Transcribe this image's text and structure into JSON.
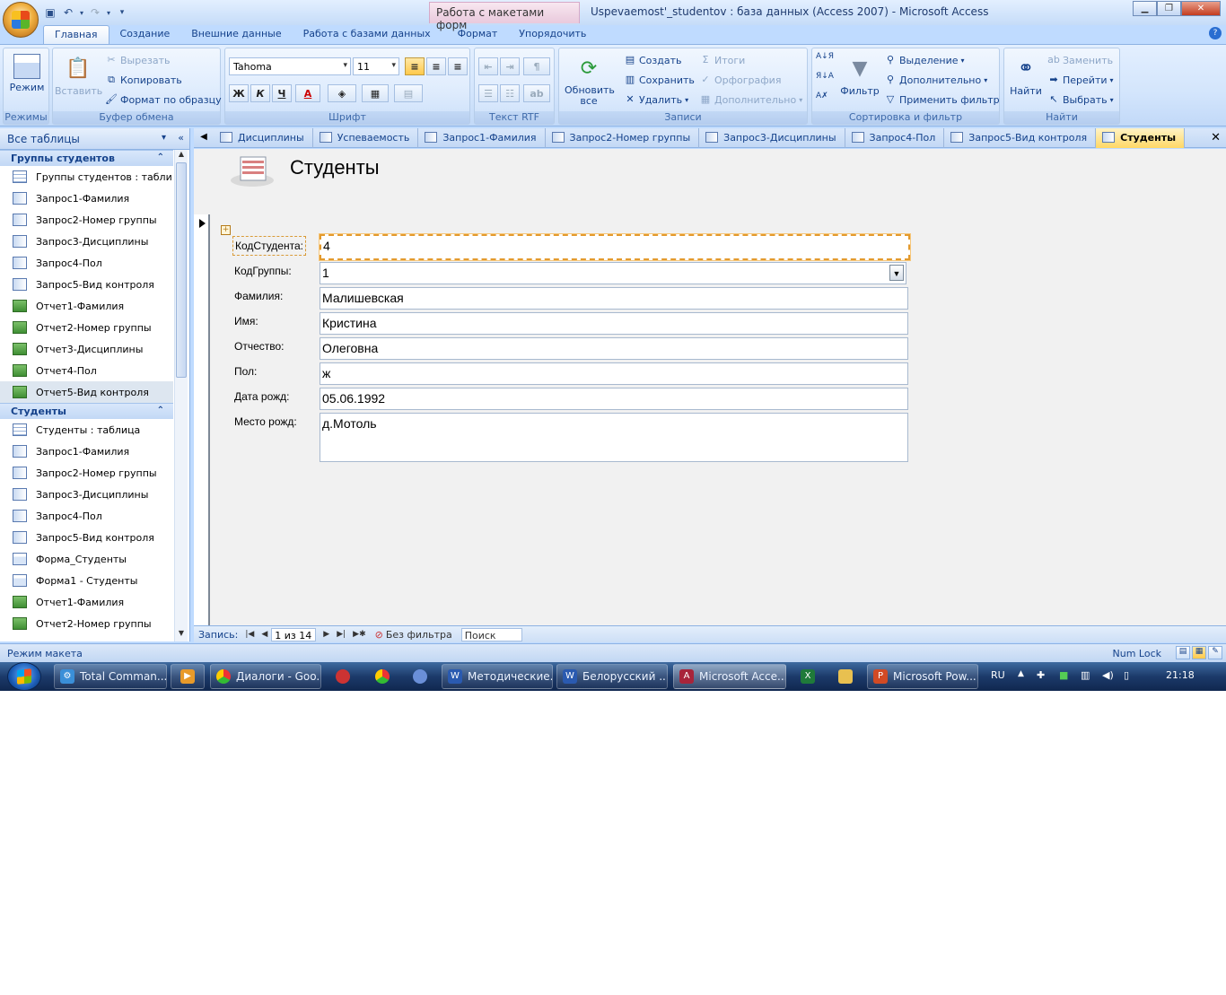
{
  "window": {
    "context_tab": "Работа с макетами форм",
    "title": "Uspevaemost'_studentov : база данных (Access 2007) - Microsoft Access"
  },
  "ribbon_tabs": [
    "Главная",
    "Создание",
    "Внешние данные",
    "Работа с базами данных",
    "Формат",
    "Упорядочить"
  ],
  "ribbon": {
    "views": {
      "mode": "Режим",
      "group": "Режимы"
    },
    "clipboard": {
      "paste": "Вставить",
      "cut": "Вырезать",
      "copy": "Копировать",
      "format_painter": "Формат по образцу",
      "group": "Буфер обмена"
    },
    "font": {
      "name": "Tahoma",
      "size": "11",
      "group": "Шрифт"
    },
    "rtf": {
      "group": "Текст RTF"
    },
    "records": {
      "refresh": "Обновить все",
      "new": "Создать",
      "save": "Сохранить",
      "delete": "Удалить",
      "totals": "Итоги",
      "spelling": "Орфография",
      "more": "Дополнительно",
      "group": "Записи"
    },
    "sort_filter": {
      "filter": "Фильтр",
      "selection": "Выделение",
      "advanced": "Дополнительно",
      "apply": "Применить фильтр",
      "group": "Сортировка и фильтр"
    },
    "find": {
      "find": "Найти",
      "replace": "Заменить",
      "goto": "Перейти",
      "select": "Выбрать",
      "group": "Найти"
    }
  },
  "nav": {
    "header": "Все таблицы",
    "groups": [
      {
        "title": "Группы студентов",
        "items": [
          {
            "icon": "table",
            "label": "Группы студентов : табли..."
          },
          {
            "icon": "query",
            "label": "Запрос1-Фамилия"
          },
          {
            "icon": "query",
            "label": "Запрос2-Номер группы"
          },
          {
            "icon": "query",
            "label": "Запрос3-Дисциплины"
          },
          {
            "icon": "query",
            "label": "Запрос4-Пол"
          },
          {
            "icon": "query",
            "label": "Запрос5-Вид контроля"
          },
          {
            "icon": "report",
            "label": "Отчет1-Фамилия"
          },
          {
            "icon": "report",
            "label": "Отчет2-Номер группы"
          },
          {
            "icon": "report",
            "label": "Отчет3-Дисциплины"
          },
          {
            "icon": "report",
            "label": "Отчет4-Пол"
          },
          {
            "icon": "report",
            "label": "Отчет5-Вид контроля"
          }
        ]
      },
      {
        "title": "Студенты",
        "items": [
          {
            "icon": "table",
            "label": "Студенты : таблица"
          },
          {
            "icon": "query",
            "label": "Запрос1-Фамилия"
          },
          {
            "icon": "query",
            "label": "Запрос2-Номер группы"
          },
          {
            "icon": "query",
            "label": "Запрос3-Дисциплины"
          },
          {
            "icon": "query",
            "label": "Запрос4-Пол"
          },
          {
            "icon": "query",
            "label": "Запрос5-Вид контроля"
          },
          {
            "icon": "form",
            "label": "Форма_Студенты"
          },
          {
            "icon": "form",
            "label": "Форма1 - Студенты"
          },
          {
            "icon": "report",
            "label": "Отчет1-Фамилия"
          },
          {
            "icon": "report",
            "label": "Отчет2-Номер группы"
          }
        ]
      }
    ]
  },
  "doc_tabs": [
    {
      "icon": "table",
      "label": "Дисциплины"
    },
    {
      "icon": "table",
      "label": "Успеваемость"
    },
    {
      "icon": "query",
      "label": "Запрос1-Фамилия"
    },
    {
      "icon": "query",
      "label": "Запрос2-Номер группы"
    },
    {
      "icon": "query",
      "label": "Запрос3-Дисциплины"
    },
    {
      "icon": "query",
      "label": "Запрос4-Пол"
    },
    {
      "icon": "query",
      "label": "Запрос5-Вид контроля"
    },
    {
      "icon": "form",
      "label": "Студенты"
    }
  ],
  "form": {
    "title": "Студенты",
    "fields": [
      {
        "label": "КодСтудента:",
        "value": "4"
      },
      {
        "label": "КодГруппы:",
        "value": "1"
      },
      {
        "label": "Фамилия:",
        "value": "Малишевская"
      },
      {
        "label": "Имя:",
        "value": "Кристина"
      },
      {
        "label": "Отчество:",
        "value": "Олеговна"
      },
      {
        "label": "Пол:",
        "value": "ж"
      },
      {
        "label": "Дата рожд:",
        "value": "05.06.1992"
      },
      {
        "label": "Место рожд:",
        "value": "д.Мотоль"
      }
    ]
  },
  "record_nav": {
    "label": "Запись:",
    "position": "1 из 14",
    "filter": "Без фильтра",
    "search": "Поиск"
  },
  "status": {
    "left": "Режим макета",
    "right": "Num Lock"
  },
  "taskbar": {
    "buttons": [
      "Total Comman...",
      "",
      "Диалоги - Goo...",
      "",
      "",
      "",
      "Методические...",
      "Белорусский ...",
      "Microsoft Acce...",
      "",
      "",
      "Microsoft Pow..."
    ],
    "lang": "RU",
    "time": "21:18"
  }
}
